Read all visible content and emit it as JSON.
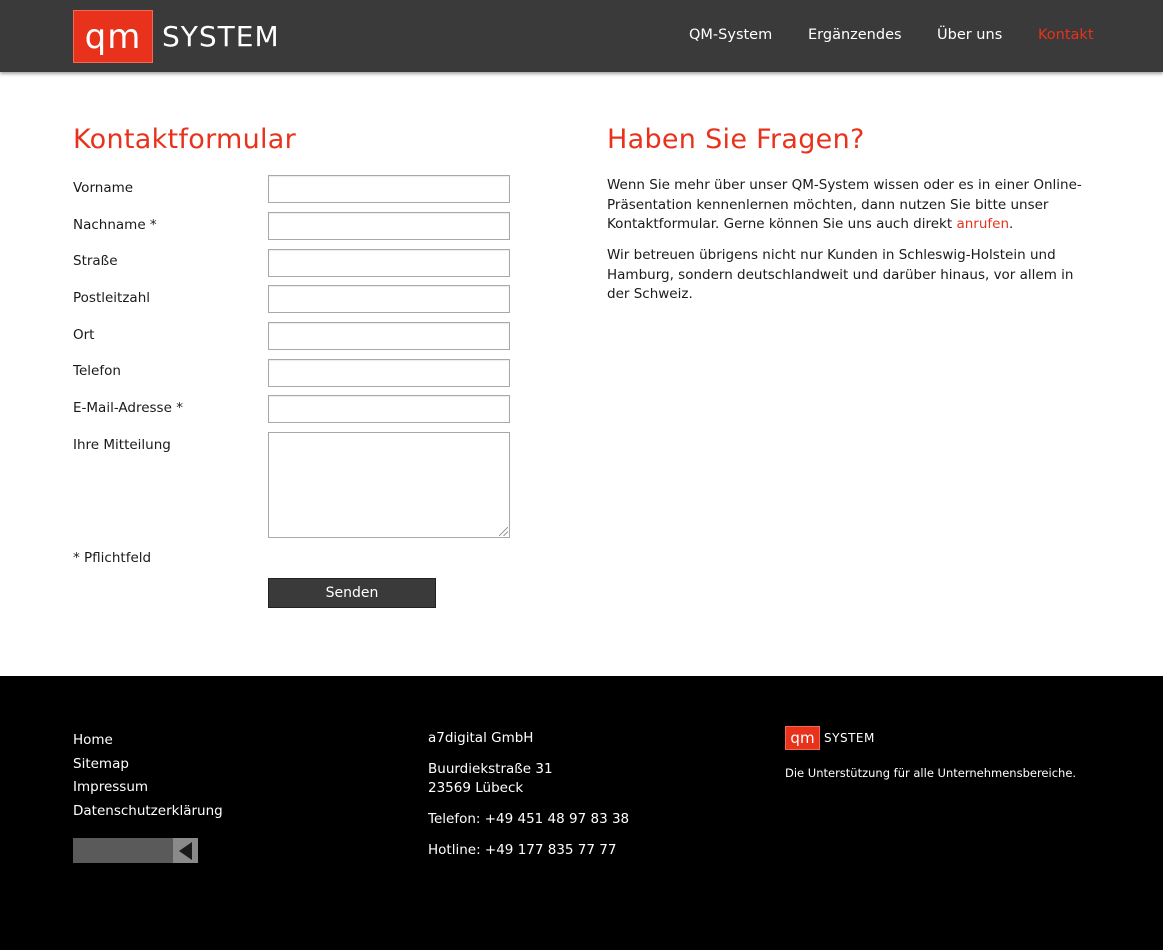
{
  "header": {
    "logo_mark": "qm",
    "logo_text": "SYSTEM",
    "nav": [
      "QM-System",
      "Ergänzendes",
      "Über uns",
      "Kontakt"
    ],
    "active_nav": "Kontakt"
  },
  "form": {
    "title": "Kontaktformular",
    "fields": [
      {
        "label": "Vorname",
        "value": ""
      },
      {
        "label": "Nachname *",
        "value": ""
      },
      {
        "label": "Straße",
        "value": ""
      },
      {
        "label": "Postleitzahl",
        "value": ""
      },
      {
        "label": "Ort",
        "value": ""
      },
      {
        "label": "Telefon",
        "value": ""
      },
      {
        "label": "E-Mail-Adresse *",
        "value": ""
      }
    ],
    "message_label": "Ihre Mitteilung",
    "message_value": "",
    "required_note": "* Pflichtfeld",
    "submit_label": "Senden"
  },
  "questions": {
    "title": "Haben Sie Fragen?",
    "paragraph1_text": "Wenn Sie mehr über unser QM-System wissen oder es in einer Online-Präsentation kennenlernen möchten, dann nutzen Sie bitte unser Kontaktformular. Gerne können Sie uns auch direkt ",
    "paragraph1_link": "anrufen",
    "paragraph1_end": ".",
    "paragraph2": "Wir betreuen übrigens nicht nur Kunden in Schleswig-Holstein und Hamburg, sondern deutschlandweit und darüber hinaus, vor allem in der Schweiz."
  },
  "footer": {
    "links": [
      "Home",
      "Sitemap",
      "Impressum",
      "Datenschutzerklärung"
    ],
    "company": "a7digital GmbH",
    "street": "Buurdiekstraße 31",
    "city": "23569 Lübeck",
    "phone": "Telefon: +49 451 48 97 83 38",
    "hotline": "Hotline: +49 177 835 77 77",
    "logo_mark": "qm",
    "logo_text": "SYSTEM",
    "tagline": "Die Unterstützung für alle Unternehmensbereiche."
  },
  "colors": {
    "accent": "#e8321b",
    "header_bg": "#3a3a3a",
    "footer_bg": "#000000"
  },
  "icons": [
    "scroll-left-icon"
  ]
}
